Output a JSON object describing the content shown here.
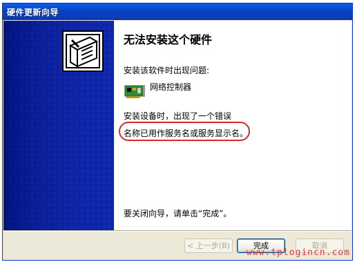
{
  "window": {
    "title": "硬件更新向导"
  },
  "sidebar": {
    "icon": "hardware-box-icon",
    "color": "#0a1fa0"
  },
  "main": {
    "heading": "无法安装这个硬件",
    "problem_intro": "安装该软件时出现问题:",
    "device": {
      "icon": "network-card-icon",
      "name": "网络控制器"
    },
    "error_line1": "安装设备时，出现了一个错误",
    "error_line2": "名称已用作服务名或服务显示名。",
    "highlight_color": "#d12a2a",
    "finish_hint": "要关闭向导，请单击“完成”。"
  },
  "buttons": {
    "back": "< 上一步(B)",
    "finish": "完成",
    "cancel": "取消"
  },
  "watermark": "www.tplogincn.com"
}
